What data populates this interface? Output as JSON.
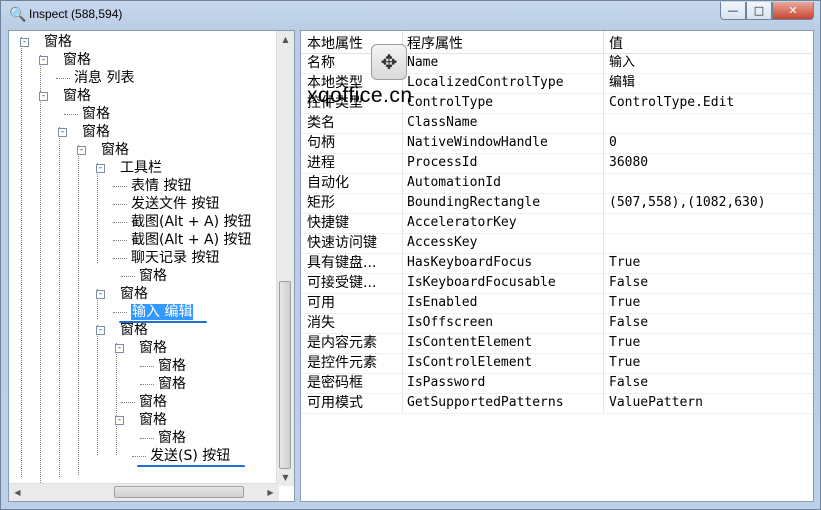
{
  "window": {
    "title": "Inspect  (588,594)"
  },
  "caption": {
    "min": "—",
    "max": "□",
    "close": "✕"
  },
  "tree": [
    {
      "label": "窗格"
    },
    {
      "label": "窗格"
    },
    {
      "label": "消息 列表"
    },
    {
      "label": "窗格"
    },
    {
      "label": "窗格"
    },
    {
      "label": "窗格"
    },
    {
      "label": "窗格"
    },
    {
      "label": "工具栏"
    },
    {
      "label": "表情 按钮"
    },
    {
      "label": "发送文件 按钮"
    },
    {
      "label": "截图(Alt + A) 按钮"
    },
    {
      "label": "截图(Alt + A) 按钮"
    },
    {
      "label": "聊天记录 按钮"
    },
    {
      "label": "窗格"
    },
    {
      "label": "窗格"
    },
    {
      "label": "输入 编辑"
    },
    {
      "label": "窗格"
    },
    {
      "label": "窗格"
    },
    {
      "label": "窗格"
    },
    {
      "label": "窗格"
    },
    {
      "label": "窗格"
    },
    {
      "label": "窗格"
    },
    {
      "label": "窗格"
    },
    {
      "label": "发送(S) 按钮"
    }
  ],
  "grid": {
    "headers": [
      "本地属性",
      "程序属性",
      "值"
    ],
    "rows": [
      [
        "名称",
        "Name",
        "输入"
      ],
      [
        "本地类型",
        "LocalizedControlType",
        "编辑"
      ],
      [
        "控件类型",
        "ControlType",
        "ControlType.Edit"
      ],
      [
        "类名",
        "ClassName",
        ""
      ],
      [
        "句柄",
        "NativeWindowHandle",
        "0"
      ],
      [
        "进程",
        "ProcessId",
        "36080"
      ],
      [
        "自动化",
        "AutomationId",
        ""
      ],
      [
        "矩形",
        "BoundingRectangle",
        "(507,558),(1082,630)"
      ],
      [
        "快捷键",
        "AcceleratorKey",
        ""
      ],
      [
        "快速访问键",
        "AccessKey",
        ""
      ],
      [
        "具有键盘...",
        "HasKeyboardFocus",
        "True"
      ],
      [
        "可接受键...",
        "IsKeyboardFocusable",
        "False"
      ],
      [
        "可用",
        "IsEnabled",
        "True"
      ],
      [
        "消失",
        "IsOffscreen",
        "False"
      ],
      [
        "是内容元素",
        "IsContentElement",
        "True"
      ],
      [
        "是控件元素",
        "IsControlElement",
        "True"
      ],
      [
        "是密码框",
        "IsPassword",
        "False"
      ],
      [
        "可用模式",
        "GetSupportedPatterns",
        "ValuePattern"
      ]
    ]
  },
  "watermark": "xqoffice.cn",
  "icons": {
    "app": "inspect-magnifier-icon",
    "move": "move-arrows-icon"
  }
}
